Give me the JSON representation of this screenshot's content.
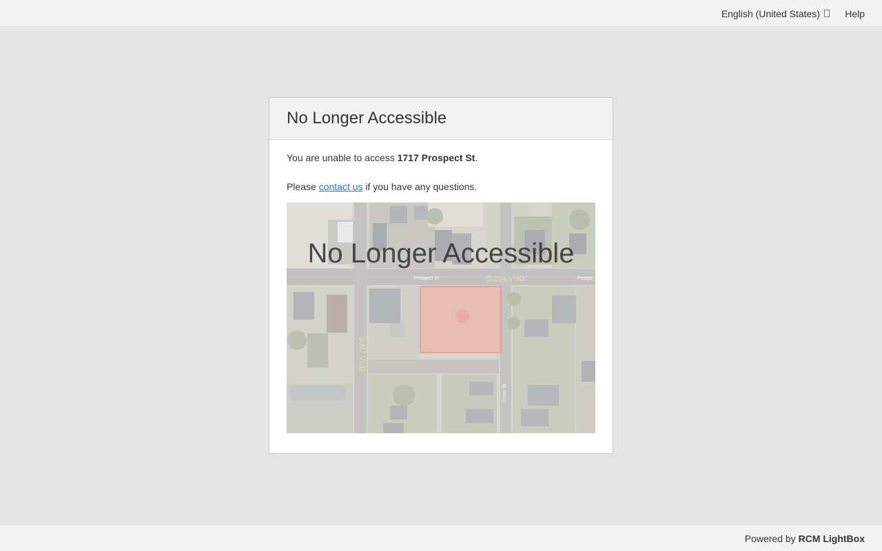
{
  "topbar": {
    "language_label": "English (United States)",
    "help_label": "Help"
  },
  "card": {
    "title": "No Longer Accessible",
    "message_prefix": "You are unable to access ",
    "address": "1717 Prospect St",
    "message_suffix": ".",
    "contact_prefix": "Please ",
    "contact_link": "contact us",
    "contact_suffix": " if you have any questions."
  },
  "map": {
    "overlay_title": "No Longer Accessible",
    "street_label_1": "Prospect St",
    "street_label_2": "Prospe",
    "street_label_3": "Cross St",
    "road_label_horizontal": "S.204 VHD",
    "road_label_vertical": "S.N7 VHD",
    "parcel_color": "#f08a7e"
  },
  "footer": {
    "powered_prefix": "Powered by ",
    "brand": "RCM LightBox"
  }
}
